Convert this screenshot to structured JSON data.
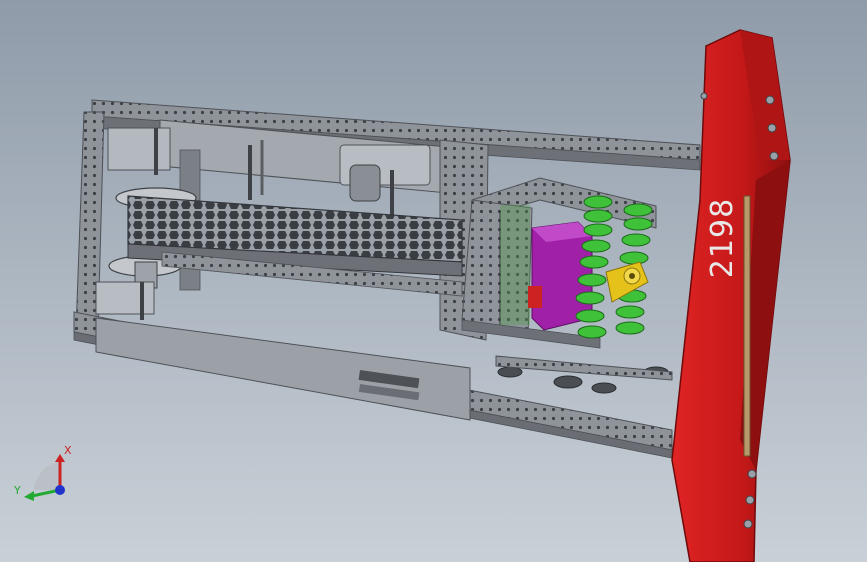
{
  "viewport": {
    "background_top": "#8f9ba9",
    "background_bottom": "#c9d0d7"
  },
  "model": {
    "bumper_text": "2198",
    "colors": {
      "frame": "#8c9096",
      "frame_dark": "#4e5257",
      "bumper": "#cc1b1b",
      "bumper_dark": "#8e0f10",
      "intake_roller": "#3fc23a",
      "motor": "#a020a8",
      "gearbox": "#e4c21a"
    }
  },
  "triad": {
    "x_label": "X",
    "y_label": "Y",
    "x_color": "#cc2222",
    "y_color": "#22aa33",
    "z_color": "#2233cc"
  }
}
